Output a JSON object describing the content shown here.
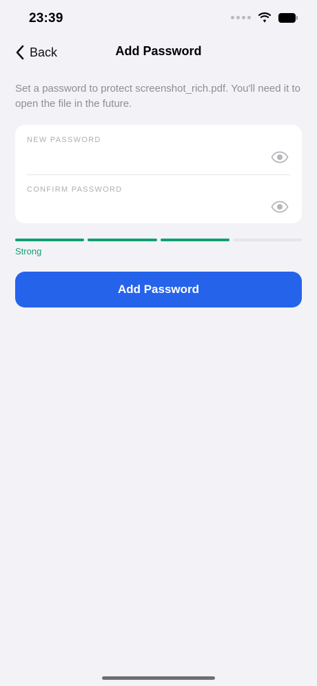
{
  "status_bar": {
    "time": "23:39"
  },
  "nav": {
    "back_label": "Back",
    "title": "Add Password"
  },
  "description": "Set a password to protect screenshot_rich.pdf. You'll need it to open the file in the future.",
  "form": {
    "new_password": {
      "label": "NEW PASSWORD",
      "value": ""
    },
    "confirm_password": {
      "label": "CONFIRM PASSWORD",
      "value": ""
    }
  },
  "strength": {
    "label": "Strong",
    "filled_segments": 3,
    "total_segments": 4,
    "color": "#12a06e"
  },
  "submit_button": {
    "label": "Add Password",
    "color": "#2563eb"
  },
  "icons": {
    "back": "chevron-left-icon",
    "show_password": "eye-icon",
    "wifi": "wifi-icon",
    "battery": "battery-icon"
  }
}
